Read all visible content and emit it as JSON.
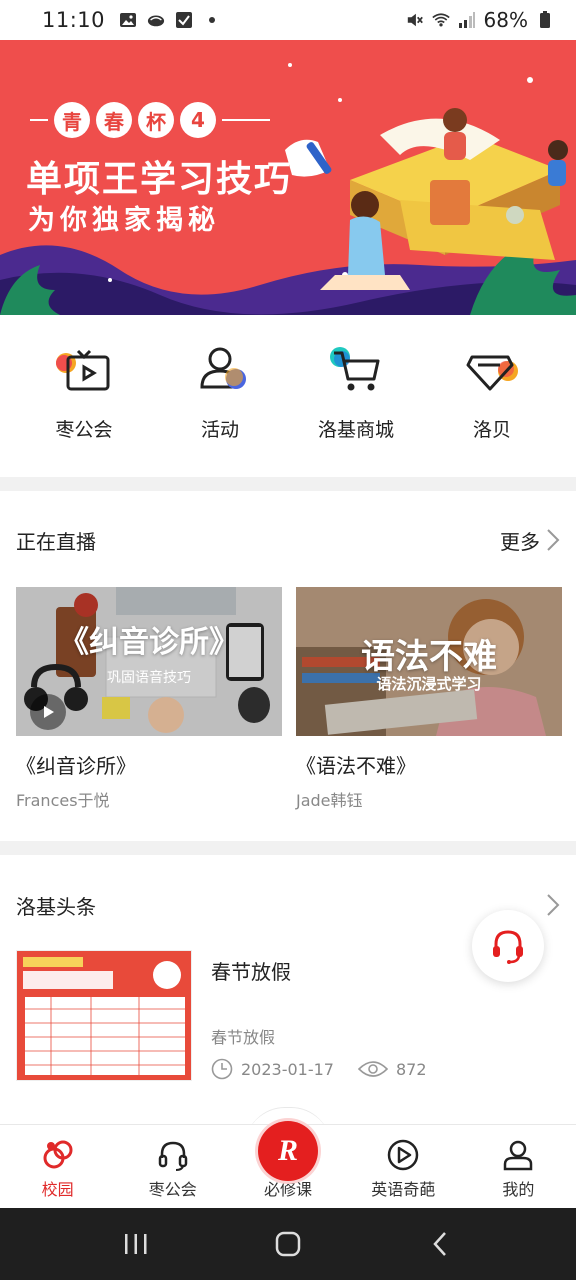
{
  "status_bar": {
    "time": "11:10",
    "battery": "68%"
  },
  "banner": {
    "tag_prefix": [
      "青",
      "春",
      "杯",
      "4"
    ],
    "title": "单项王学习技巧",
    "subtitle": "为你独家揭秘"
  },
  "quick_menu": {
    "items": [
      {
        "label": "枣公会",
        "icon": "tv-icon"
      },
      {
        "label": "活动",
        "icon": "people-icon"
      },
      {
        "label": "洛基商城",
        "icon": "cart-icon"
      },
      {
        "label": "洛贝",
        "icon": "diamond-icon"
      }
    ]
  },
  "live": {
    "section_title": "正在直播",
    "more_label": "更多",
    "cards": [
      {
        "thumb_title": "《纠音诊所》",
        "thumb_sub": "巩固语音技巧",
        "title": "《纠音诊所》",
        "host": "Frances于悦"
      },
      {
        "thumb_title": "语法不难",
        "thumb_sub": "语法沉浸式学习",
        "title": "《语法不难》",
        "host": "Jade韩钰"
      }
    ]
  },
  "headlines": {
    "section_title": "洛基头条",
    "items": [
      {
        "title": "春节放假",
        "summary": "春节放假",
        "date": "2023-01-17",
        "views": "872"
      }
    ]
  },
  "tab_bar": {
    "tabs": [
      {
        "label": "校园",
        "active": true
      },
      {
        "label": "枣公会",
        "active": false
      },
      {
        "label": "必修课",
        "active": false
      },
      {
        "label": "英语奇葩",
        "active": false
      },
      {
        "label": "我的",
        "active": false
      }
    ]
  },
  "colors": {
    "brand_red": "#e41f1f",
    "banner_red": "#ef4e4c",
    "active_tab": "#e02a2a"
  }
}
